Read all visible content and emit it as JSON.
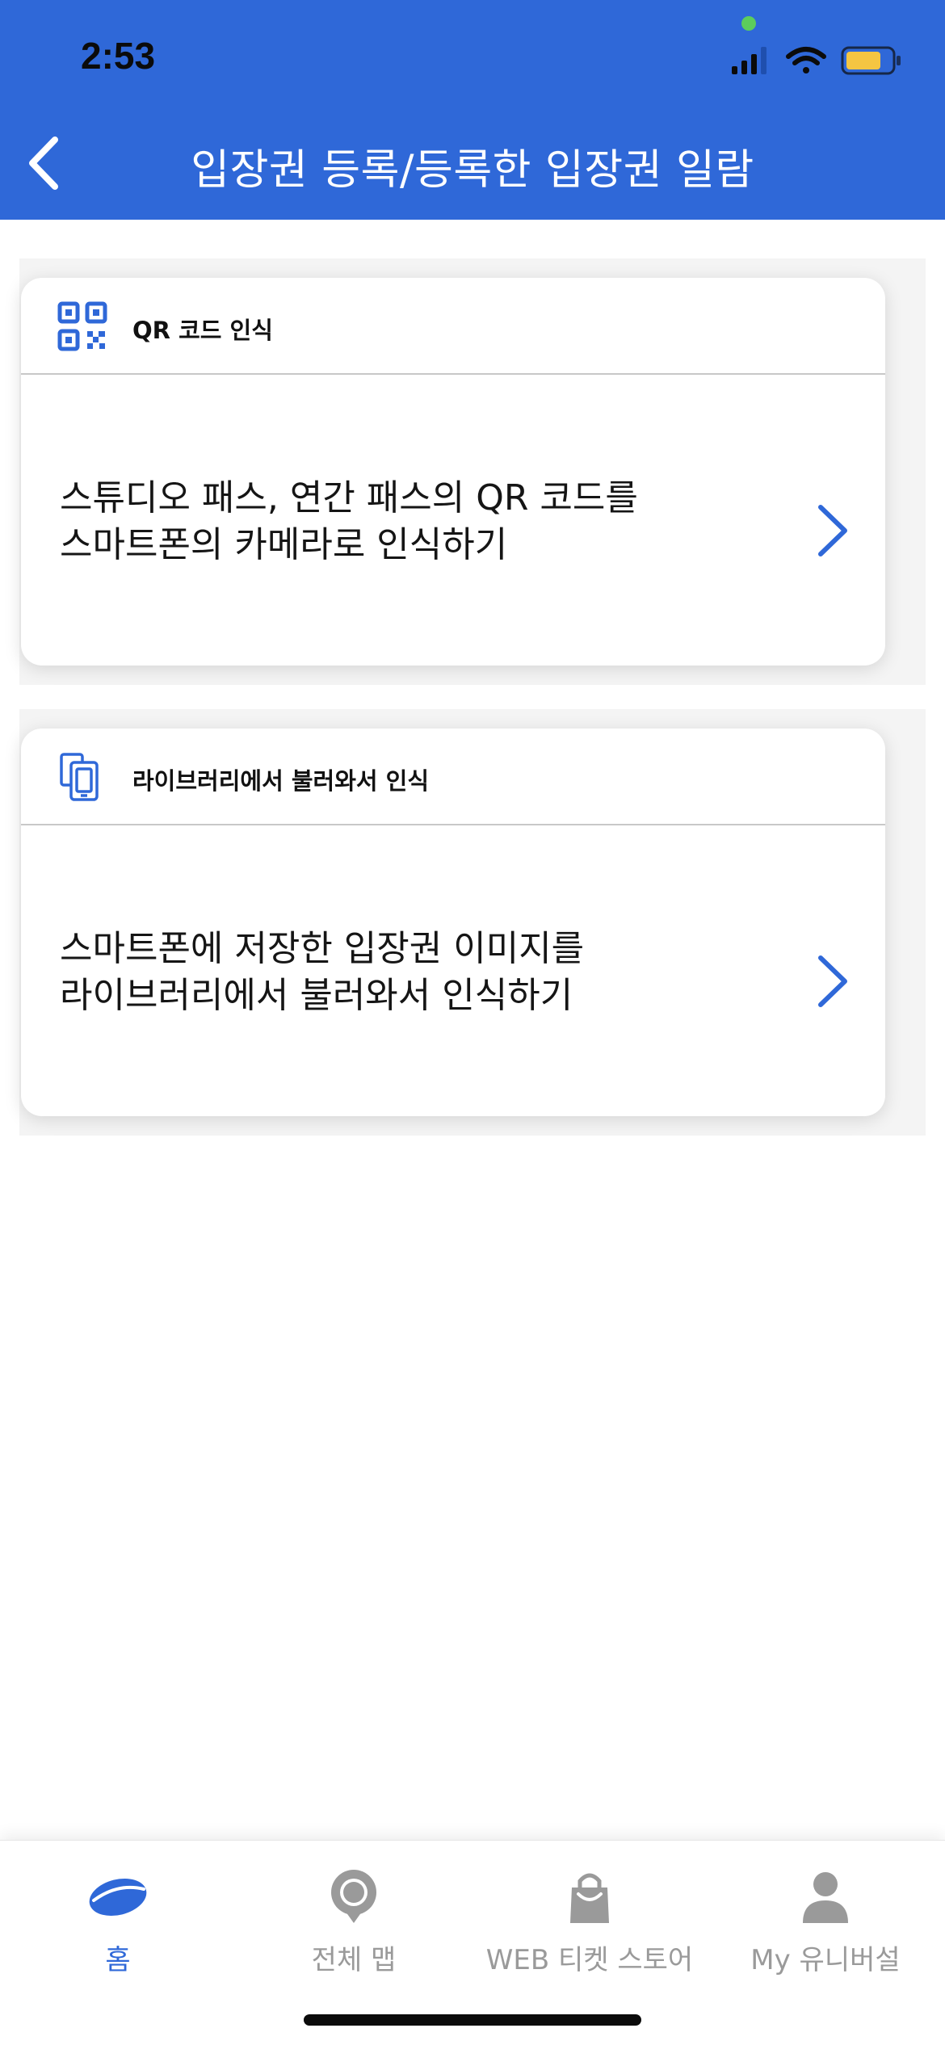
{
  "status_bar": {
    "time": "2:53"
  },
  "header": {
    "title": "입장권 등록/등록한 입장권 일람",
    "back_icon": "chevron-left-icon",
    "background": "#2f68d8"
  },
  "cards": [
    {
      "icon": "qr-code-icon",
      "label": "QR 코드 인식",
      "line1": "스튜디오 패스, 연간 패스의 QR 코드를",
      "line2": "스마트폰의 카메라로 인식하기"
    },
    {
      "icon": "library-images-icon",
      "label": "라이브러리에서 불러와서 인식",
      "line1": "스마트폰에 저장한 입장권 이미지를",
      "line2": "라이브러리에서 불러와서 인식하기"
    }
  ],
  "tabbar": {
    "tabs": [
      {
        "label": "홈",
        "icon": "planet-home-icon",
        "active": true
      },
      {
        "label": "전체 맵",
        "icon": "map-pin-icon",
        "active": false
      },
      {
        "label": "WEB 티켓 스토어",
        "icon": "shopping-bag-icon",
        "active": false
      },
      {
        "label": "My 유니버설",
        "icon": "person-icon",
        "active": false
      }
    ]
  },
  "colors": {
    "accent": "#2f68d8",
    "inactive": "#9a9a9a"
  }
}
